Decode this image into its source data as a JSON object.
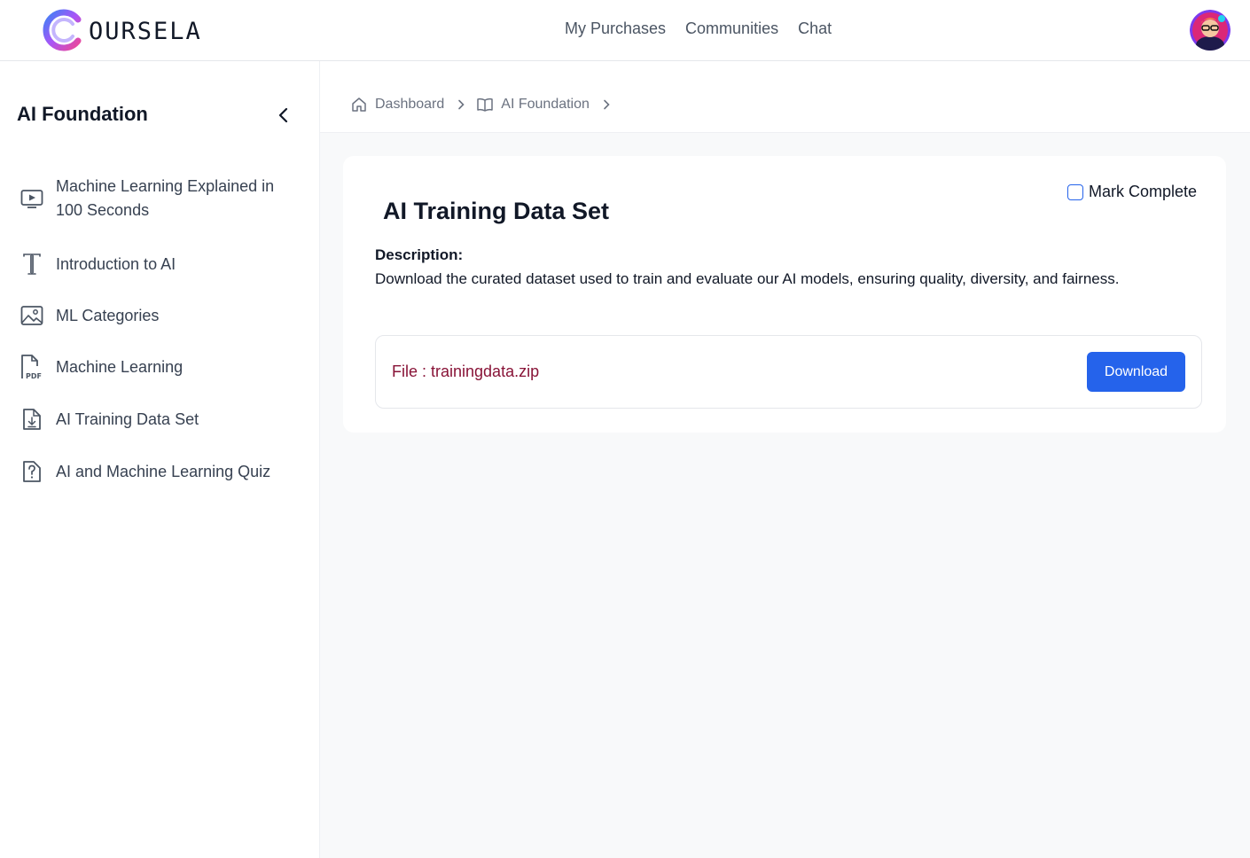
{
  "brand": {
    "name": "OURSELA",
    "logo_icon": "coursela-c-logo"
  },
  "topnav": {
    "items": [
      {
        "label": "My Purchases"
      },
      {
        "label": "Communities"
      },
      {
        "label": "Chat"
      }
    ]
  },
  "user": {
    "avatar_icon": "user-avatar"
  },
  "sidebar": {
    "course_title": "AI Foundation",
    "collapse_icon": "chevron-left-icon",
    "lessons": [
      {
        "label": "Machine Learning Explained in 100 Seconds",
        "icon": "video-icon"
      },
      {
        "label": "Introduction to AI",
        "icon": "text-icon"
      },
      {
        "label": "ML Categories",
        "icon": "image-icon"
      },
      {
        "label": "Machine Learning",
        "icon": "pdf-icon"
      },
      {
        "label": "AI Training Data Set",
        "icon": "download-file-icon"
      },
      {
        "label": "AI and Machine Learning Quiz",
        "icon": "quiz-icon"
      }
    ]
  },
  "breadcrumb": {
    "items": [
      {
        "label": "Dashboard",
        "icon": "home-icon"
      },
      {
        "label": "AI Foundation",
        "icon": "book-icon"
      }
    ]
  },
  "content": {
    "title": "AI Training Data Set",
    "mark_complete_label": "Mark Complete",
    "mark_complete_checked": false,
    "description_label": "Description:",
    "description_text": "Download the curated dataset used to train and evaluate our AI models, ensuring quality, diversity, and fairness.",
    "file_label": "File : trainingdata.zip",
    "download_label": "Download"
  },
  "colors": {
    "accent": "#2563eb",
    "file_text": "#881337",
    "logo_gradient": [
      "#3b82f6",
      "#a855f7",
      "#ec4899"
    ],
    "main_bg": "#f8f9fa"
  }
}
